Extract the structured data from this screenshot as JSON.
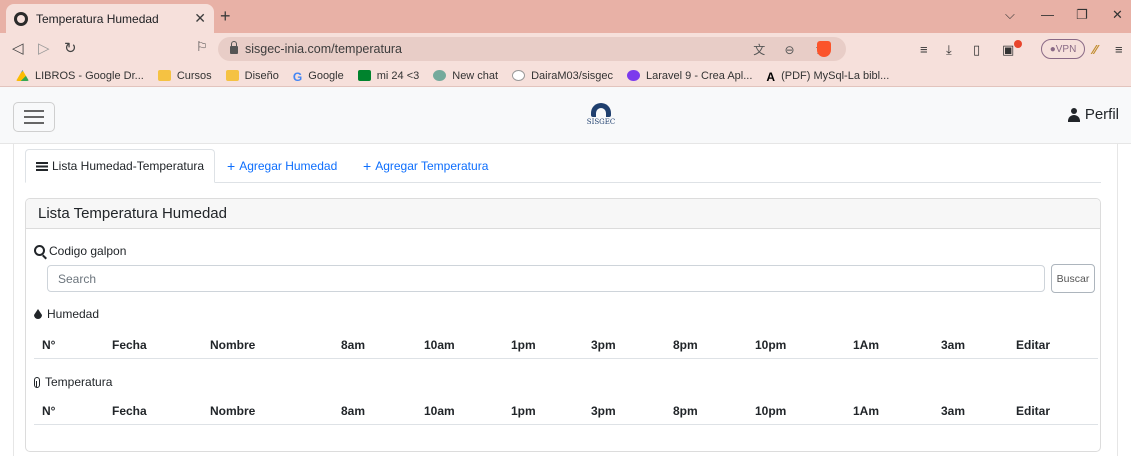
{
  "browser": {
    "tab_title": "Temperatura Humedad",
    "url": "sisgec-inia.com/temperatura",
    "vpn_label": "VPN",
    "bookmarks": [
      {
        "label": "LIBROS - Google Dr...",
        "icon": "drive-icon"
      },
      {
        "label": "Cursos",
        "icon": "folder-icon"
      },
      {
        "label": "Diseño",
        "icon": "folder-icon"
      },
      {
        "label": "Google",
        "icon": "google-icon"
      },
      {
        "label": "mi 24 <3",
        "icon": "meet-icon"
      },
      {
        "label": "New chat",
        "icon": "chatgpt-icon"
      },
      {
        "label": "DairaM03/sisgec",
        "icon": "github-icon"
      },
      {
        "label": "Laravel 9 - Crea Apl...",
        "icon": "laravel-icon"
      },
      {
        "label": "(PDF) MySql-La bibl...",
        "icon": "pdf-icon"
      }
    ]
  },
  "navbar": {
    "logo_text": "SISGEC",
    "profile_label": "Perfil"
  },
  "tabs": [
    {
      "label": "Lista Humedad-Temperatura",
      "active": true
    },
    {
      "label": "Agregar Humedad",
      "active": false
    },
    {
      "label": "Agregar Temperatura",
      "active": false
    }
  ],
  "card": {
    "title": "Lista Temperatura Humedad",
    "search_label": "Codigo galpon",
    "search_placeholder": "Search",
    "search_button": "Buscar",
    "humedad_label": "Humedad",
    "temperatura_label": "Temperatura"
  },
  "table_columns": [
    "N°",
    "Fecha",
    "Nombre",
    "8am",
    "10am",
    "1pm",
    "3pm",
    "8pm",
    "10pm",
    "1Am",
    "3am",
    "Editar"
  ],
  "colors": {
    "tab_strip": "#e8b1a6",
    "toolbar": "#f6e0db",
    "link": "#0d6efd"
  }
}
